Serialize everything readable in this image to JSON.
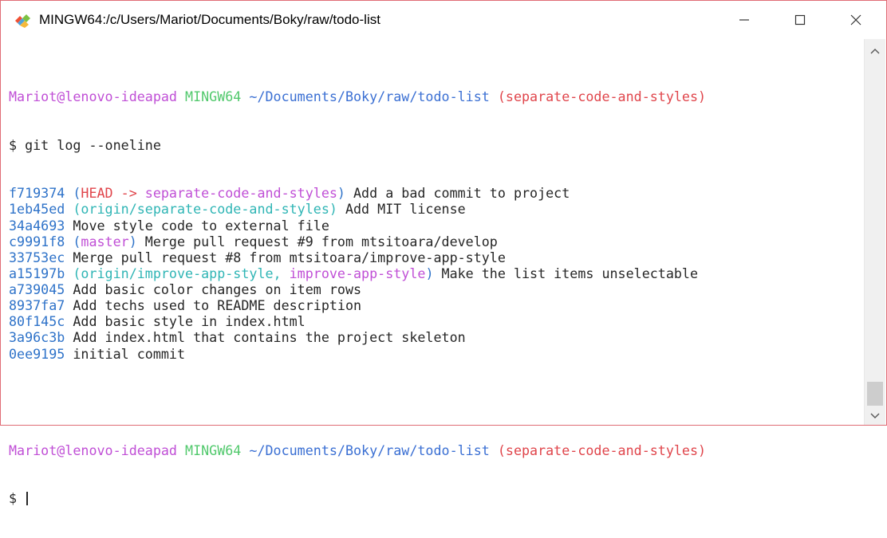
{
  "window": {
    "title": "MINGW64:/c/Users/Mariot/Documents/Boky/raw/todo-list",
    "icons": {
      "app": "git-bash-icon",
      "minimize": "minimize-icon",
      "maximize": "maximize-icon",
      "close": "close-icon"
    }
  },
  "colors": {
    "user": "#c04fd6",
    "mingw": "#52c96d",
    "path": "#3a6fd3",
    "branch": "#e0454b",
    "hash": "#2f73c9",
    "origin": "#2fb5b5",
    "text": "#262626",
    "border": "#e06c75"
  },
  "prompt1": {
    "user": "Mariot@lenovo-ideapad",
    "env": "MINGW64",
    "path": "~/Documents/Boky/raw/todo-list",
    "branch": "(separate-code-and-styles)",
    "command": "$ git log --oneline"
  },
  "log": [
    {
      "hash": "f719374",
      "refs": [
        {
          "t": "(",
          "c": "hash"
        },
        {
          "t": "HEAD -> ",
          "c": "branch"
        },
        {
          "t": "separate-code-and-styles",
          "c": "user"
        },
        {
          "t": ")",
          "c": "hash"
        }
      ],
      "message": "Add a bad commit to project"
    },
    {
      "hash": "1eb45ed",
      "refs": [
        {
          "t": "(origin/separate-code-and-styles)",
          "c": "origin"
        }
      ],
      "message": "Add MIT license"
    },
    {
      "hash": "34a4693",
      "refs": [],
      "message": "Move style code to external file"
    },
    {
      "hash": "c9991f8",
      "refs": [
        {
          "t": "(",
          "c": "hash"
        },
        {
          "t": "master",
          "c": "user"
        },
        {
          "t": ")",
          "c": "hash"
        }
      ],
      "message": "Merge pull request #9 from mtsitoara/develop"
    },
    {
      "hash": "33753ec",
      "refs": [],
      "message": "Merge pull request #8 from mtsitoara/improve-app-style"
    },
    {
      "hash": "a15197b",
      "refs": [
        {
          "t": "(origin/improve-app-style, ",
          "c": "origin"
        },
        {
          "t": "improve-app-style",
          "c": "user"
        },
        {
          "t": ")",
          "c": "hash"
        }
      ],
      "message": "Make the list items unselectable"
    },
    {
      "hash": "a739045",
      "refs": [],
      "message": "Add basic color changes on item rows"
    },
    {
      "hash": "8937fa7",
      "refs": [],
      "message": "Add techs used to README description"
    },
    {
      "hash": "80f145c",
      "refs": [],
      "message": "Add basic style in index.html"
    },
    {
      "hash": "3a96c3b",
      "refs": [],
      "message": "Add index.html that contains the project skeleton"
    },
    {
      "hash": "0ee9195",
      "refs": [],
      "message": "initial commit"
    }
  ],
  "prompt2": {
    "user": "Mariot@lenovo-ideapad",
    "env": "MINGW64",
    "path": "~/Documents/Boky/raw/todo-list",
    "branch": "(separate-code-and-styles)",
    "command": "$ "
  },
  "scrollbar": {
    "up_icon": "chevron-up-icon",
    "down_icon": "chevron-down-icon"
  }
}
